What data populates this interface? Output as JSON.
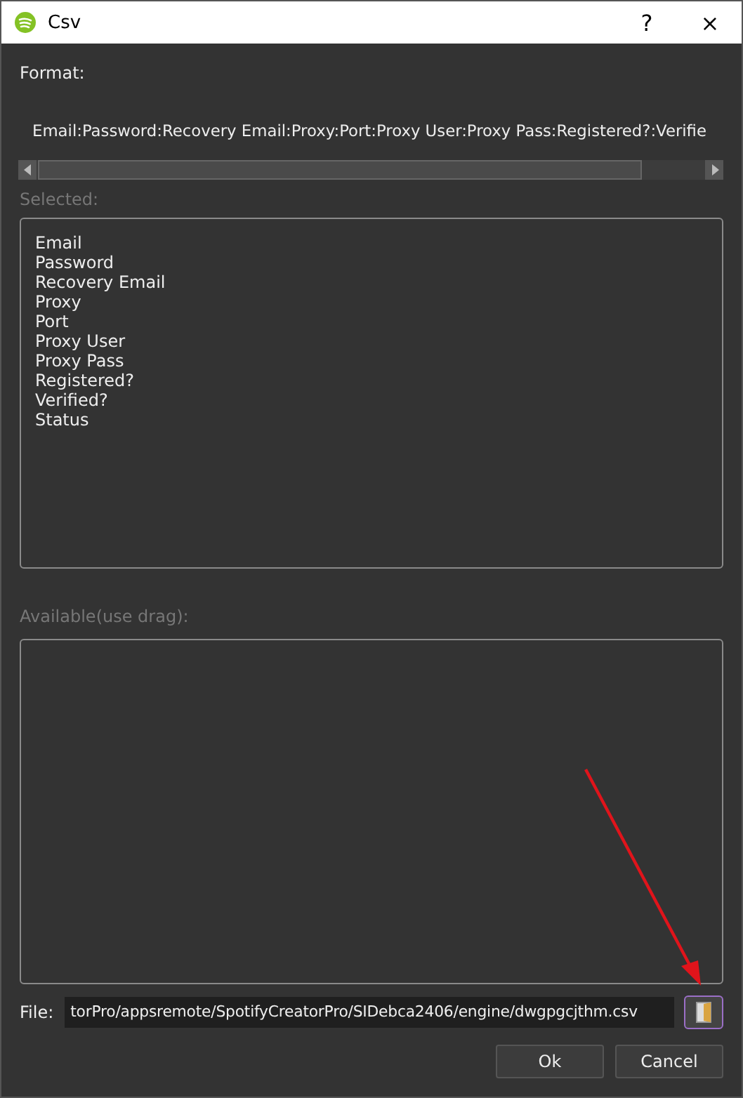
{
  "window": {
    "title": "Csv",
    "help": "?",
    "close": "×"
  },
  "format": {
    "label": "Format:",
    "value": "Email:Password:Recovery Email:Proxy:Port:Proxy User:Proxy Pass:Registered?:Verifie"
  },
  "selected": {
    "label": "Selected:",
    "items": [
      "Email",
      "Password",
      "Recovery Email",
      "Proxy",
      "Port",
      "Proxy User",
      "Proxy Pass",
      "Registered?",
      "Verified?",
      "Status"
    ]
  },
  "available": {
    "label": "Available(use drag):"
  },
  "file": {
    "label": "File:",
    "value": "torPro/appsremote/SpotifyCreatorPro/SIDebca2406/engine/dwgpgcjthm.csv"
  },
  "buttons": [
    "Ok",
    "Cancel"
  ]
}
